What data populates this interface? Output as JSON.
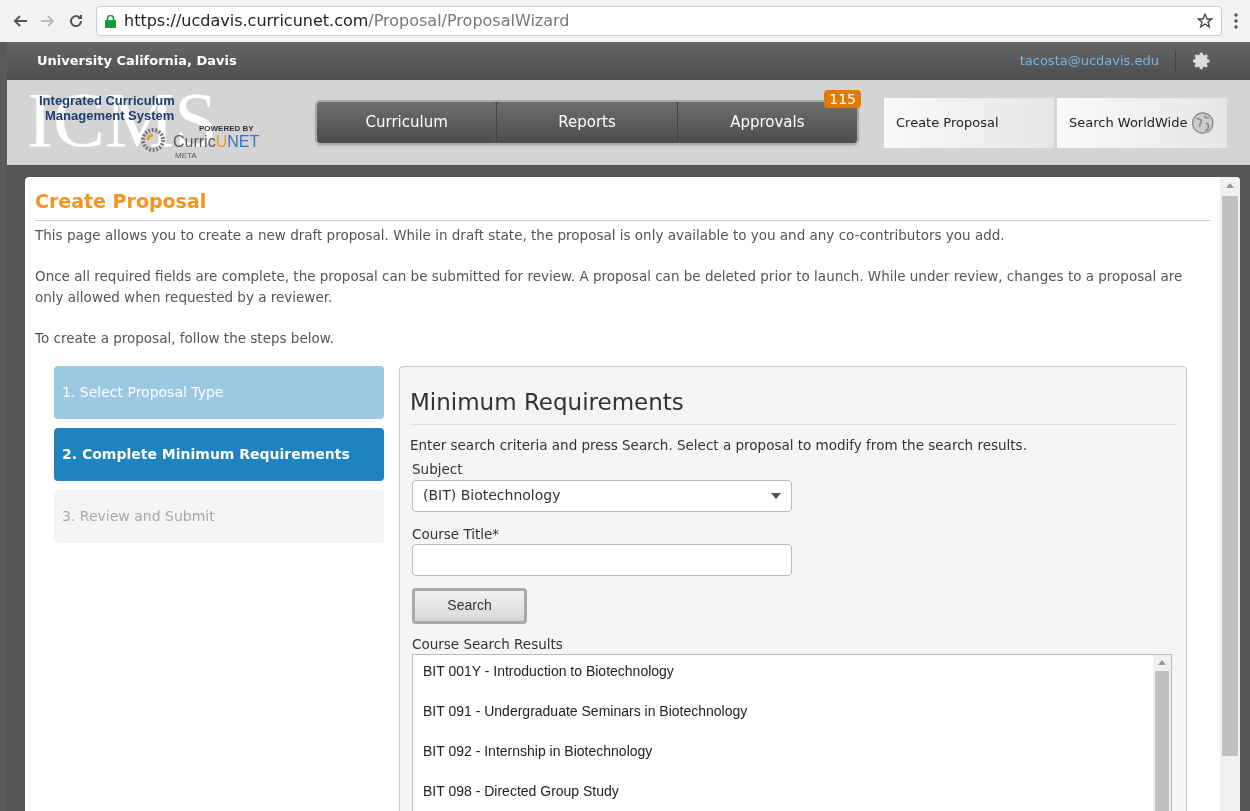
{
  "browser": {
    "url_host": "https://ucdavis.curricunet.com",
    "url_path": "/Proposal/ProposalWizard"
  },
  "header": {
    "institution": "University California, Davis",
    "user_email": "tacosta@ucdavis.edu"
  },
  "logo": {
    "backdrop": "ICMS",
    "title_line_1": "Integrated Curriculum",
    "title_line_2": "Management System",
    "powered_by": "POWERED BY",
    "brand_a": "Curric",
    "brand_b": "UNET",
    "brand_sub": "META"
  },
  "nav": {
    "items": [
      {
        "label": "Curriculum"
      },
      {
        "label": "Reports"
      },
      {
        "label": "Approvals",
        "badge": "115"
      }
    ],
    "actions": [
      {
        "label": "Create Proposal",
        "kind": "plain"
      },
      {
        "label": "Search WorldWide",
        "kind": "globe"
      }
    ]
  },
  "page": {
    "title": "Create Proposal",
    "paragraphs": [
      "This page allows you to create a new draft proposal. While in draft state, the proposal is only available to you and any co-contributors you add.",
      "Once all required fields are complete, the proposal can be submitted for review. A proposal can be deleted prior to launch. While under review, changes to a proposal are only allowed when requested by a reviewer.",
      "To create a proposal, follow the steps below."
    ]
  },
  "steps": [
    {
      "label": "1. Select Proposal Type",
      "kind": "done",
      "selected": false
    },
    {
      "label": "2. Complete Minimum Requirements",
      "kind": "current",
      "selected": true
    },
    {
      "label": "3. Review and Submit",
      "kind": "pending",
      "selected": false
    }
  ],
  "form": {
    "title": "Minimum Requirements",
    "instructions": "Enter search criteria and press Search. Select a proposal to modify from the search results.",
    "subject_label": "Subject",
    "subject_value": "(BIT) Biotechnology",
    "course_title_label": "Course Title*",
    "search_button": "Search",
    "results_label": "Course Search Results",
    "results": [
      "BIT 001Y - Introduction to Biotechnology",
      "BIT 091 - Undergraduate Seminars in Biotechnology",
      "BIT 092 - Internship in Biotechnology",
      "BIT 098 - Directed Group Study"
    ]
  }
}
